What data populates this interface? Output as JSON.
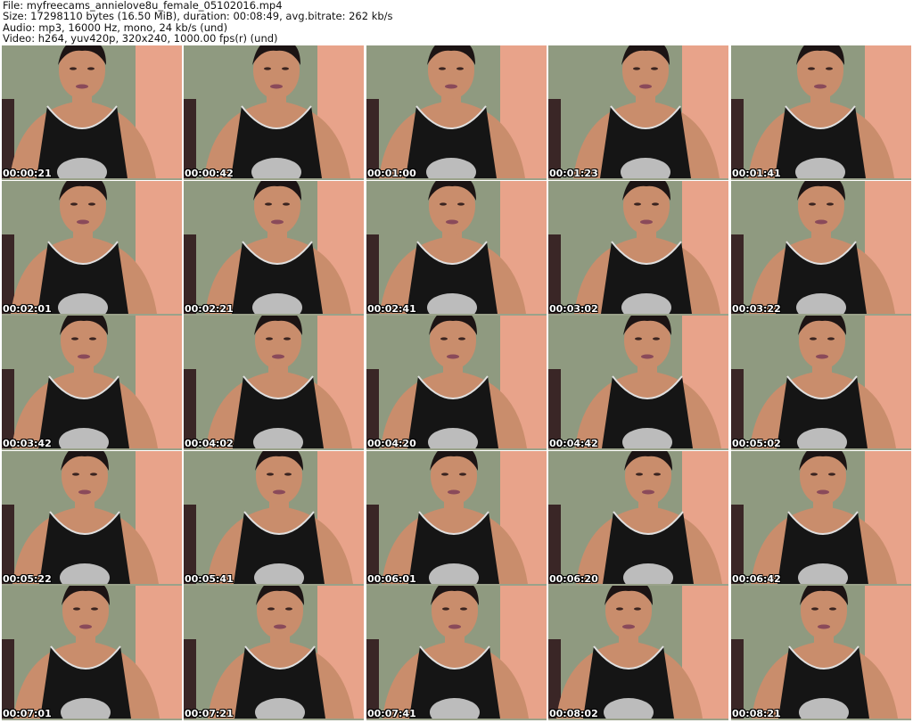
{
  "header": {
    "file_line": "File: myfreecams_annielove8u_female_05102016.mp4",
    "size_line": "Size: 17298110 bytes (16.50 MiB), duration: 00:08:49, avg.bitrate: 262 kb/s",
    "audio_line": "Audio: mp3, 16000 Hz, mono, 24 kb/s (und)",
    "video_line": "Video: h264, yuv420p, 320x240, 1000.00 fps(r) (und)"
  },
  "thumbnails": [
    "00:00:21",
    "00:00:42",
    "00:01:00",
    "00:01:23",
    "00:01:41",
    "00:02:01",
    "00:02:21",
    "00:02:41",
    "00:03:02",
    "00:03:22",
    "00:03:42",
    "00:04:02",
    "00:04:20",
    "00:04:42",
    "00:05:02",
    "00:05:22",
    "00:05:41",
    "00:06:01",
    "00:06:20",
    "00:06:42",
    "00:07:01",
    "00:07:21",
    "00:07:41",
    "00:08:02",
    "00:08:21"
  ],
  "colors": {
    "wall_left": "#8f9a80",
    "wall_right": "#e8a38a",
    "skin": "#c98d6c",
    "hair": "#1c1414",
    "top": "#151515",
    "print": "#d9d9d9",
    "timestamp": "#ffffff"
  }
}
